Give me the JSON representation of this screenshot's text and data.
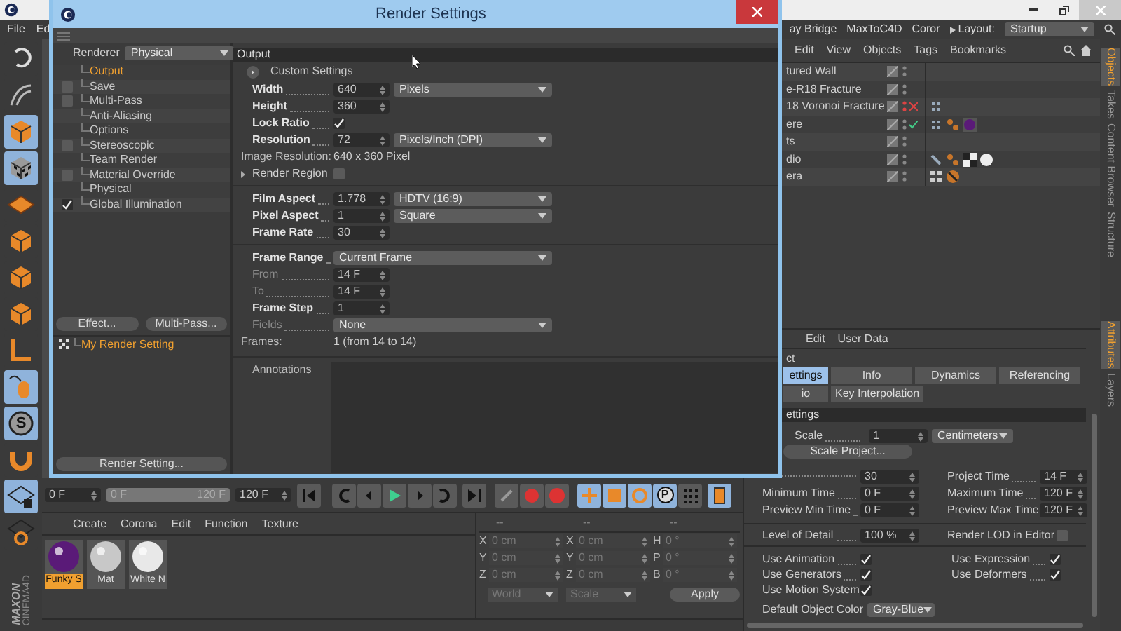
{
  "app": {
    "menu_left": [
      "File",
      "Ed"
    ],
    "menu_right": [
      "ay Bridge",
      "MaxToC4D",
      "Coror"
    ],
    "layout_label": "Layout:",
    "layout_value": "Startup",
    "logo": [
      "MAXON",
      "CINEMA4D"
    ]
  },
  "tools": [
    {
      "kind": "undo",
      "selected": false
    },
    {
      "kind": "sculpt",
      "selected": false
    },
    {
      "kind": "cube",
      "selected": true
    },
    {
      "kind": "checker",
      "selected": true
    },
    {
      "kind": "plane",
      "selected": false
    },
    {
      "kind": "cube",
      "selected": false
    },
    {
      "kind": "cube",
      "selected": false
    },
    {
      "kind": "cube",
      "selected": false
    },
    {
      "kind": "corner",
      "selected": false
    },
    {
      "kind": "mouse",
      "selected": true
    },
    {
      "kind": "letter",
      "label": "S",
      "selected": true
    },
    {
      "kind": "magnet",
      "selected": false
    },
    {
      "kind": "gridlock",
      "selected": true
    },
    {
      "kind": "gridrot",
      "selected": false
    }
  ],
  "dialog": {
    "title": "Render Settings",
    "renderer_label": "Renderer",
    "renderer_value": "Physical",
    "tree": [
      {
        "label": "Output",
        "kind": "plain",
        "selected": true
      },
      {
        "label": "Save",
        "kind": "checkbox",
        "checked": false,
        "selected": false
      },
      {
        "label": "Multi-Pass",
        "kind": "checkbox",
        "checked": false,
        "selected": false
      },
      {
        "label": "Anti-Aliasing",
        "kind": "plain",
        "selected": false
      },
      {
        "label": "Options",
        "kind": "plain",
        "selected": false
      },
      {
        "label": "Stereoscopic",
        "kind": "checkbox",
        "checked": false,
        "selected": false
      },
      {
        "label": "Team Render",
        "kind": "plain",
        "selected": false
      },
      {
        "label": "Material Override",
        "kind": "checkbox",
        "checked": false,
        "selected": false
      },
      {
        "label": "Physical",
        "kind": "plain",
        "selected": false
      },
      {
        "label": "Global Illumination",
        "kind": "checkbox",
        "checked": true,
        "selected": false
      }
    ],
    "buttons": [
      "Effect...",
      "Multi-Pass..."
    ],
    "setting_name": "My Render Setting",
    "bottom_button": "Render Setting...",
    "section": "Output",
    "custom_settings": "Custom Settings",
    "groups": [
      [
        {
          "kind": "field",
          "label": "Width",
          "value": "640",
          "unit": "Pixels",
          "disabled": false
        },
        {
          "kind": "field",
          "label": "Height",
          "value": "360",
          "disabled": false
        },
        {
          "kind": "check",
          "label": "Lock Ratio",
          "checked": true,
          "disabled": false
        },
        {
          "kind": "field",
          "label": "Resolution",
          "value": "72",
          "unit": "Pixels/Inch (DPI)",
          "disabled": false
        },
        {
          "kind": "info",
          "label": "Image Resolution:",
          "value": "640 x 360 Pixel"
        },
        {
          "kind": "expander",
          "label": "Render Region",
          "checked": false,
          "expanded": false
        }
      ],
      [
        {
          "kind": "field",
          "label": "Film Aspect",
          "value": "1.778",
          "unit": "HDTV (16:9)",
          "disabled": false
        },
        {
          "kind": "field",
          "label": "Pixel Aspect",
          "value": "1",
          "unit": "Square",
          "disabled": false
        },
        {
          "kind": "field",
          "label": "Frame Rate",
          "value": "30",
          "disabled": false
        }
      ],
      [
        {
          "kind": "dropdown",
          "label": "Frame Range",
          "value": "Current Frame",
          "disabled": false
        },
        {
          "kind": "field",
          "label": "From",
          "value": "14 F",
          "disabled": true
        },
        {
          "kind": "field",
          "label": "To",
          "value": "14 F",
          "disabled": true
        },
        {
          "kind": "field",
          "label": "Frame Step",
          "value": "1",
          "disabled": false
        },
        {
          "kind": "dropdown",
          "label": "Fields",
          "value": "None",
          "disabled": true
        },
        {
          "kind": "info",
          "label": "Frames:",
          "value": "1 (from 14 to 14)"
        }
      ]
    ],
    "annotations_label": "Annotations"
  },
  "timeline": {
    "start": "0 F",
    "slider_start": "0 F",
    "slider_end": "120 F",
    "end": "120 F",
    "param_letter": "P"
  },
  "materials": {
    "menu": [
      "Create",
      "Corona",
      "Edit",
      "Function",
      "Texture"
    ],
    "items": [
      {
        "name": "Funky S",
        "color": "#5a1a78",
        "selected": true
      },
      {
        "name": "Mat",
        "color": "#c8c8c8",
        "selected": false
      },
      {
        "name": "White N",
        "color": "#e8e8e8",
        "selected": false
      }
    ]
  },
  "coords": {
    "headers": [
      "--",
      "--",
      "--"
    ],
    "rows": [
      {
        "axes": [
          "X",
          "X",
          "H"
        ],
        "values": [
          "0 cm",
          "0 cm",
          "0 °"
        ]
      },
      {
        "axes": [
          "Y",
          "Y",
          "P"
        ],
        "values": [
          "0 cm",
          "0 cm",
          "0 °"
        ]
      },
      {
        "axes": [
          "Z",
          "Z",
          "B"
        ],
        "values": [
          "0 cm",
          "0 cm",
          "0 °"
        ]
      }
    ],
    "dropdowns": [
      "World",
      "Scale"
    ],
    "apply": "Apply"
  },
  "objects": {
    "menu": [
      "Edit",
      "View",
      "Objects",
      "Tags",
      "Bookmarks"
    ],
    "rows": [
      {
        "name": "tured Wall",
        "hidden": false,
        "kind": "plain"
      },
      {
        "name": "e-R18 Fracture",
        "hidden": false,
        "kind": "plain"
      },
      {
        "name": "18 Voronoi Fracture",
        "hidden": true,
        "kind": "generator",
        "enabled": false,
        "tags": [
          {
            "kind": "dots"
          }
        ]
      },
      {
        "name": "ere",
        "hidden": false,
        "kind": "generator",
        "enabled": true,
        "tags": [
          {
            "kind": "dots"
          },
          {
            "kind": "orange"
          },
          {
            "kind": "sphere"
          }
        ]
      },
      {
        "name": "ts",
        "hidden": false,
        "kind": "plain"
      },
      {
        "name": "dio",
        "hidden": false,
        "kind": "plain",
        "tags": [
          {
            "kind": "pin"
          },
          {
            "kind": "orange"
          },
          {
            "kind": "checker"
          },
          {
            "kind": "ball"
          }
        ]
      },
      {
        "name": "era",
        "hidden": false,
        "kind": "plain",
        "tags": [
          {
            "kind": "target"
          },
          {
            "kind": "nosign"
          }
        ]
      }
    ]
  },
  "attributes": {
    "menu": [
      "Edit",
      "User Data"
    ],
    "title": "ct",
    "tabs": [
      [
        {
          "label": "ettings",
          "selected": true
        },
        {
          "label": "Info",
          "selected": false
        },
        {
          "label": "Dynamics",
          "selected": false
        },
        {
          "label": "Referencing",
          "selected": false
        }
      ],
      [
        {
          "label": "io",
          "selected": false
        },
        {
          "label": "Key Interpolation",
          "selected": false
        }
      ]
    ],
    "section": "ettings",
    "scale": {
      "label": "Scale",
      "value": "1",
      "unit": "Centimeters"
    },
    "scale_button": "Scale Project...",
    "pairs": [
      [
        {
          "value": "30"
        },
        {
          "label": "Project Time",
          "value": "14 F"
        }
      ],
      [
        {
          "label": "Minimum Time",
          "value": "0 F"
        },
        {
          "label": "Maximum Time",
          "value": "120 F"
        }
      ],
      [
        {
          "label": "Preview Min Time",
          "value": "0 F"
        },
        {
          "label": "Preview Max Time",
          "value": "120 F"
        }
      ]
    ],
    "lod": {
      "label": "Level of Detail",
      "value": "100 %"
    },
    "render_lod": {
      "label": "Render LOD in Editor",
      "checked": false
    },
    "checks": [
      [
        {
          "label": "Use Animation",
          "checked": true
        },
        {
          "label": "Use Expression",
          "checked": true
        }
      ],
      [
        {
          "label": "Use Generators",
          "checked": true
        },
        {
          "label": "Use Deformers",
          "checked": true
        }
      ],
      [
        {
          "label": "Use Motion System",
          "checked": true
        }
      ]
    ],
    "color": {
      "label": "Default Object Color",
      "value": "Gray-Blue"
    }
  },
  "side_tabs": {
    "top": [
      {
        "label": "Objects",
        "selected": true
      },
      {
        "label": "Takes",
        "selected": false
      },
      {
        "label": "Content Browser",
        "selected": false
      },
      {
        "label": "Structure",
        "selected": false
      }
    ],
    "bottom": [
      {
        "label": "Attributes",
        "selected": true
      },
      {
        "label": "Layers",
        "selected": false
      }
    ]
  }
}
